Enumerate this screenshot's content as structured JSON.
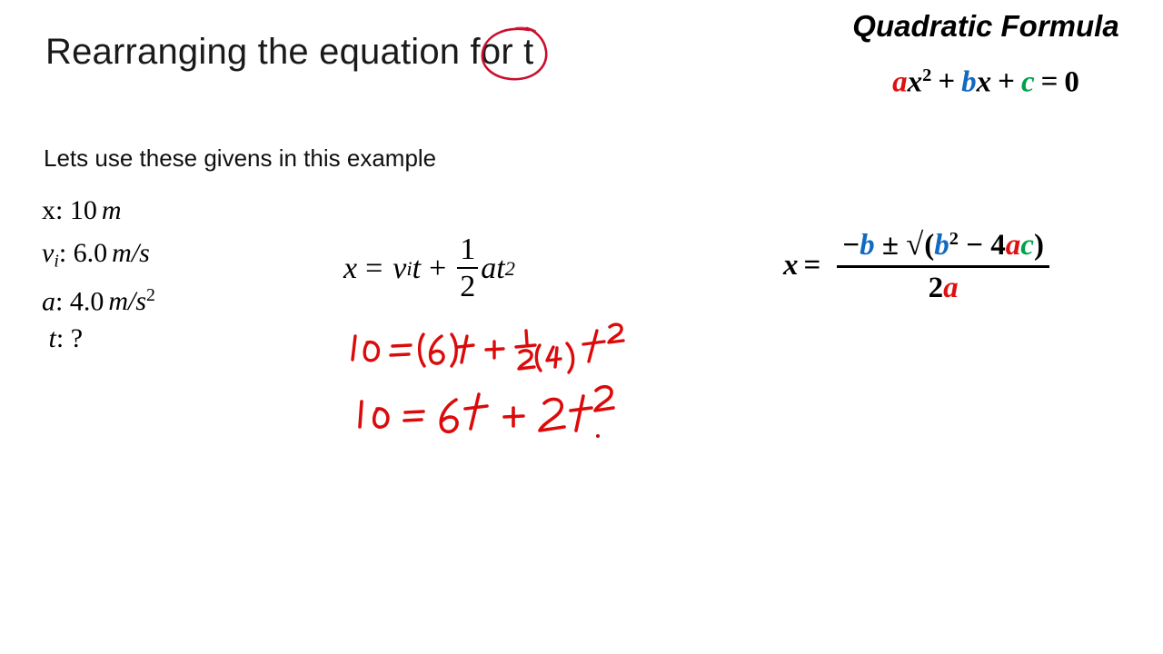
{
  "slide": {
    "title": "Rearranging the equation for t",
    "circled_term": "t",
    "background_color": "#FFFFFF"
  },
  "givens": {
    "intro": "Lets use these givens in this example",
    "rows": [
      {
        "symbol": "x",
        "symbol_style": "upright",
        "subscript": "",
        "value": "10",
        "unit": "m",
        "unit_exp": ""
      },
      {
        "symbol": "v",
        "symbol_style": "italic",
        "subscript": "i",
        "value": "6.0",
        "unit": "m/s",
        "unit_exp": ""
      },
      {
        "symbol": "a",
        "symbol_style": "italic",
        "subscript": "",
        "value": "4.0",
        "unit": "m/s",
        "unit_exp": "2"
      },
      {
        "symbol": "t",
        "symbol_style": "italic",
        "subscript": "",
        "value": "?",
        "unit": "",
        "unit_exp": ""
      }
    ],
    "separator": ":"
  },
  "kinematic_equation": {
    "lhs": "x",
    "equals": "=",
    "term1_var": "v",
    "term1_sub": "i",
    "term1_t": "t",
    "plus": "+",
    "frac_num": "1",
    "frac_den": "2",
    "term2": "at",
    "term2_exp": "2"
  },
  "handwriting": {
    "color": "#DB0B0B",
    "line1": "10 = (6)t + ½(4) t²",
    "line2": "10 = 6t + 2t²",
    "line1_parts": {
      "lhs": "10",
      "equals": "=",
      "coef_vi": "(6)",
      "var_t": "t",
      "plus": "+",
      "half_num": "1",
      "half_den": "2",
      "coef_a": "(4)",
      "var_t2": "t",
      "exp": "2"
    },
    "line2_parts": {
      "lhs": "10",
      "equals": "=",
      "term1": "6t",
      "plus": "+",
      "term2": "2t",
      "exp": "2"
    }
  },
  "quadratic": {
    "heading": "Quadratic Formula",
    "standard_form": {
      "a": "a",
      "x": "x",
      "x_exp": "2",
      "plus1": "+",
      "b": "b",
      "x2": "x",
      "plus2": "+",
      "c": "c",
      "equals": "=",
      "zero": "0"
    },
    "formula": {
      "lhs": "x",
      "equals": "=",
      "minus": "−",
      "b": "b",
      "plus_minus": "±",
      "radical": "√",
      "open_paren": "(",
      "b2": "b",
      "b2_exp": "2",
      "minus2": "−",
      "four": "4",
      "a": "a",
      "c": "c",
      "close_paren": ")",
      "den_two": "2",
      "den_a": "a"
    },
    "colors": {
      "a": "#E01010",
      "b": "#1169C0",
      "c": "#00A14B",
      "neutral": "#000000"
    }
  }
}
